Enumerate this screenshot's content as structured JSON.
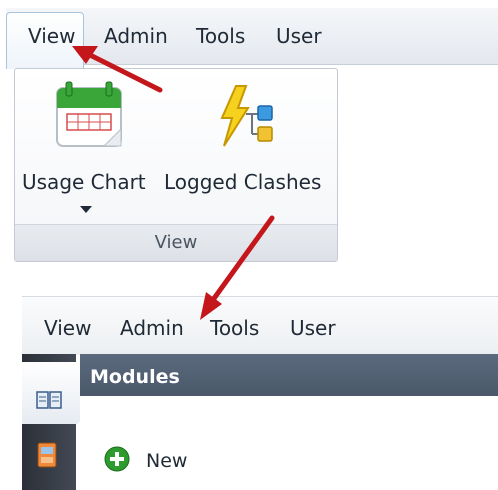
{
  "top_menu": {
    "items": [
      {
        "label": "View",
        "active": true
      },
      {
        "label": "Admin"
      },
      {
        "label": "Tools"
      },
      {
        "label": "User"
      }
    ]
  },
  "ribbon": {
    "buttons": [
      {
        "label": "Usage Chart",
        "icon": "calendar-chart-icon",
        "has_dropdown": true
      },
      {
        "label": "Logged Clashes",
        "icon": "lightning-hierarchy-icon"
      }
    ],
    "group_label": "View"
  },
  "bottom_menu": {
    "items": [
      {
        "label": "View"
      },
      {
        "label": "Admin"
      },
      {
        "label": "Tools"
      },
      {
        "label": "User"
      }
    ]
  },
  "modules": {
    "title": "Modules",
    "new_button_label": "New",
    "rail_icons": [
      "book-icon",
      "module-icon"
    ]
  },
  "colors": {
    "annotation_arrow": "#c3171c",
    "modules_header": "#536275",
    "ribbon_border": "#c3cad3",
    "new_icon": "#2e9b2e"
  }
}
